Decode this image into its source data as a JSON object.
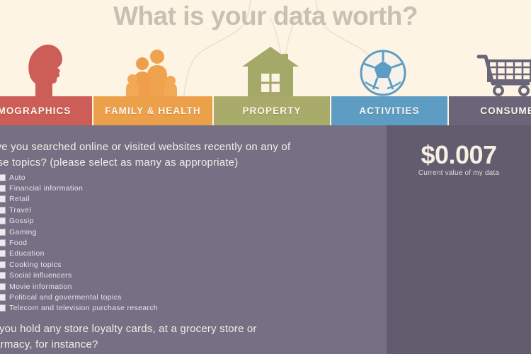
{
  "header": {
    "title": "What is your data worth?",
    "background_color": "#fdf4e4",
    "title_color": "#c9c0b4",
    "icons": [
      {
        "name": "head-silhouette-icon",
        "color": "#cc5e57"
      },
      {
        "name": "family-group-icon",
        "color": "#eda04a"
      },
      {
        "name": "house-icon",
        "color": "#a9ab6b"
      },
      {
        "name": "soccer-ball-icon",
        "color": "#5d9dc4"
      },
      {
        "name": "shopping-cart-icon",
        "color": "#6a6578"
      }
    ]
  },
  "tabs": [
    {
      "label": "DEMOGRAPHICS",
      "color": "#cc5e57",
      "selected": false
    },
    {
      "label": "FAMILY & HEALTH",
      "color": "#eda04a",
      "selected": false
    },
    {
      "label": "PROPERTY",
      "color": "#a9ab6b",
      "selected": false
    },
    {
      "label": "ACTIVITIES",
      "color": "#5d9dc4",
      "selected": true
    },
    {
      "label": "CONSUMER",
      "color": "#6a6578",
      "selected": false
    }
  ],
  "main": {
    "question_search": {
      "line1": "Have you searched online or visited websites recently on any of",
      "line2": "these topics? (please select as many as appropriate)"
    },
    "topics": [
      {
        "label": "Auto",
        "checked": false
      },
      {
        "label": "Financial information",
        "checked": false
      },
      {
        "label": "Retail",
        "checked": false
      },
      {
        "label": "Travel",
        "checked": false
      },
      {
        "label": "Gossip",
        "checked": false
      },
      {
        "label": "Gaming",
        "checked": false
      },
      {
        "label": "Food",
        "checked": false
      },
      {
        "label": "Education",
        "checked": false
      },
      {
        "label": "Cooking topics",
        "checked": false
      },
      {
        "label": "Social influencers",
        "checked": false
      },
      {
        "label": "Movie information",
        "checked": false
      },
      {
        "label": "Political and govermental topics",
        "checked": false
      },
      {
        "label": "Telecom and television purchase research",
        "checked": false
      }
    ],
    "question_loyalty": {
      "line1": "Do you hold any store loyalty cards, at a grocery store or",
      "line2": "pharmacy, for instance?"
    }
  },
  "value_panel": {
    "amount": "$0.007",
    "caption": "Current value of my data",
    "panel_color": "#615d6e"
  }
}
